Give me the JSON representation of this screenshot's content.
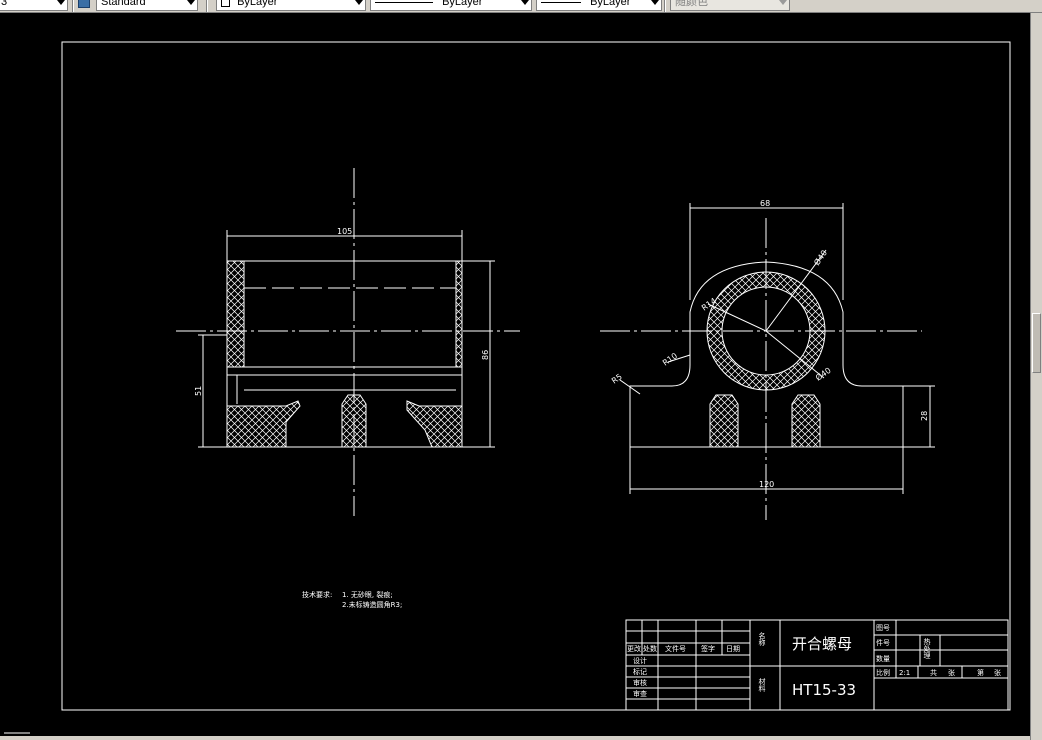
{
  "toolbar": {
    "layer_combo_value": "3",
    "textstyle_combo_value": "Standard",
    "color_combo_value": "ByLayer",
    "linetype_combo_value": "ByLayer",
    "lineweight_combo_value": "ByLayer",
    "plotstyle_combo_value": "随颜色"
  },
  "drawing": {
    "front_view": {
      "dim_width": "105",
      "dim_height": "86",
      "dim_left": "51"
    },
    "side_view": {
      "dim_top": "68",
      "dim_bottom": "120",
      "dim_right": "28",
      "dim_outer_dia": "Ø40",
      "dim_inner_dia": "Ø40",
      "dim_r14": "R14",
      "dim_r10": "R10",
      "dim_r5": "R5"
    },
    "notes": {
      "heading": "技术要求:",
      "line1": "1. 无砂眼, 裂痕;",
      "line2": "2.未标铸造圆角R3;"
    },
    "title_block": {
      "name_label": "名称",
      "part_name": "开合螺母",
      "material_label": "材料",
      "material": "HT15-33",
      "rev_headers": [
        "更改",
        "处数",
        "文件号",
        "签字",
        "日期"
      ],
      "roles": [
        "设计",
        "标记",
        "审核",
        "审查"
      ],
      "right_labels": [
        "图号",
        "件号",
        "数量",
        "比例"
      ],
      "heat_treat": "热处理",
      "scale_value": "2:1",
      "sheet_total_label": "共",
      "sheet_unit": "张",
      "sheet_no_label": "第",
      "sheet_unit_2": "张"
    }
  }
}
